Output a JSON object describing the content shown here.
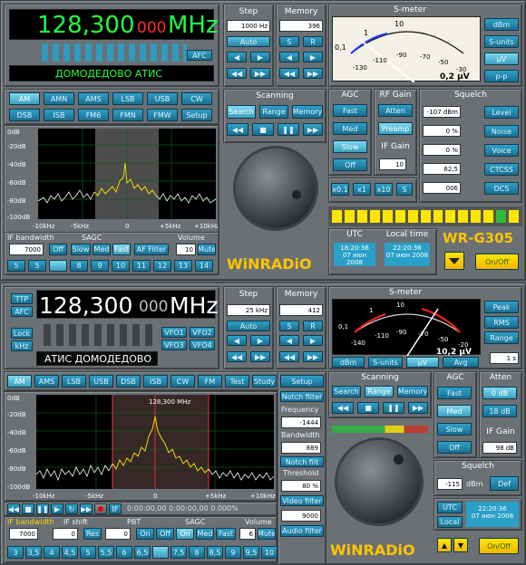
{
  "top": {
    "freq_main": "128,300",
    "freq_small": "000",
    "freq_unit": "MHz",
    "station": "ДОМОДЕДОВО АТИС",
    "afc": "AFC",
    "step": {
      "title": "Step",
      "value": "1000 Hz",
      "auto": "Auto"
    },
    "memory": {
      "title": "Memory",
      "value": "396",
      "s": "S",
      "r": "R"
    },
    "smeter": {
      "title": "S-meter",
      "reading": "0,2 μV",
      "scale": [
        "0,1",
        "1",
        "10",
        "-130",
        "-110",
        "-90",
        "-70",
        "-50",
        "-30"
      ],
      "buttons": [
        "dBm",
        "S-units",
        "μV",
        "p-p"
      ]
    },
    "modes": [
      "AM",
      "AMN",
      "AMS",
      "LSB",
      "USB",
      "CW",
      "DSB",
      "ISB",
      "FM6",
      "FMN",
      "FMW",
      "Setup"
    ],
    "scanning": {
      "title": "Scanning",
      "search": "Search",
      "range": "Range",
      "memory": "Memory"
    },
    "agc": {
      "title": "AGC",
      "items": [
        "Fast",
        "Med",
        "Slow",
        "Off"
      ]
    },
    "rfgain": {
      "title": "RF Gain",
      "atten": "Atten",
      "preamp": "Preamp",
      "ifgain_title": "IF Gain",
      "ifgain": "10"
    },
    "squelch": {
      "title": "Squelch",
      "values": [
        "-107 dBm",
        "0 %",
        "0 %",
        "62,5",
        "006"
      ],
      "buttons": [
        "Level",
        "Noise",
        "Voice",
        "CTCSS",
        "DCS"
      ]
    },
    "xbuttons": [
      "x0.1",
      "x1",
      "x10",
      "S"
    ],
    "spectrum": {
      "ylabels": [
        "0dB",
        "-20dB",
        "-40dB",
        "-60dB",
        "-80dB",
        "-100dB"
      ],
      "xlabels": [
        "-10kHz",
        "-5kHz",
        "0",
        "+5kHz",
        "+10kHz"
      ]
    },
    "bottom": {
      "ifbw_label": "IF bandwidth",
      "ifbw": "7000",
      "sagc": "SAGC",
      "off": "Off",
      "slow": "Slow",
      "med": "Med",
      "fast": "Fast",
      "affilter": "AF Filter",
      "volume_label": "Volume",
      "volume": "10",
      "mute": "Mute",
      "presets": [
        "5",
        "5",
        "",
        "8",
        "9",
        "10",
        "11",
        "12",
        "13",
        "14"
      ]
    },
    "clock": {
      "utc": "UTC",
      "local": "Local time",
      "utc_time": "18:20:36",
      "utc_date": "07 июн 2008",
      "local_time": "22:20:36",
      "local_date": "07 июн 2008"
    },
    "model": "WR-G305",
    "brand": "WiNRADiO",
    "onoff": "On/Off"
  },
  "bot": {
    "freq_main": "128,300",
    "freq_small": "000",
    "freq_unit": "MHz",
    "station": "АТИС ДОМОДЕДОВО",
    "ttp": "TTP",
    "afc": "AFC",
    "lock": "Lock",
    "khz": "kHz",
    "vfo": [
      "VFO1",
      "VFO2",
      "VFO3",
      "VFO4"
    ],
    "step": {
      "title": "Step",
      "value": "25 kHz",
      "auto": "Auto"
    },
    "memory": {
      "title": "Memory",
      "value": "412",
      "s": "S",
      "r": "R"
    },
    "smeter": {
      "title": "S-meter",
      "reading": "10,2 μV",
      "scale": [
        "0,1",
        "1",
        "10",
        "-140",
        "-110",
        "-90",
        "-70",
        "-50",
        "-20"
      ],
      "buttons": [
        "dBm",
        "S-units",
        "μV",
        "Avg"
      ],
      "side": [
        "Peak",
        "RMS",
        "Range"
      ],
      "range": "1 s"
    },
    "modes": [
      "AM",
      "AMS",
      "LSB",
      "USB",
      "DSB",
      "ISB",
      "CW",
      "FM",
      "Test",
      "Study",
      "Setup"
    ],
    "scanning": {
      "title": "Scanning",
      "search": "Search",
      "range": "Range",
      "memory": "Memory"
    },
    "agc": {
      "title": "AGC",
      "items": [
        "Fast",
        "Med",
        "Slow",
        "Off"
      ]
    },
    "atten": {
      "title": "Atten",
      "items": [
        "0 dB",
        "18 dB"
      ]
    },
    "ifgain": {
      "title": "IF Gain",
      "value": "98 dB"
    },
    "squelch": {
      "title": "Squelch",
      "value": "-115",
      "unit": "dBm",
      "def": "Def"
    },
    "right_tools": {
      "notch": "Notch filter",
      "freq_label": "Frequency",
      "freq": "-1444",
      "bw_label": "Bandwidth",
      "bw": "889",
      "notch_btn": "Notch filt",
      "thr_label": "Threshold",
      "thr": "80 %",
      "video": "Video filter",
      "video_val": "9000",
      "audio": "Audio filter"
    },
    "spectrum": {
      "marker": "128,300 MHz",
      "ylabels": [
        "0dB",
        "-20dB",
        "-40dB",
        "-60dB",
        "-80dB",
        "-100dB"
      ],
      "xlabels": [
        "-10kHz",
        "-5kHz",
        "0",
        "+5kHz",
        "+10kHz"
      ]
    },
    "recorder": {
      "time": "0:00:00,00  0:00:00,00 0.000%",
      "res": "Res"
    },
    "bottom": {
      "ifbw_label": "IF bandwidth",
      "ifshift_label": "IF shift",
      "pbt_label": "PBT",
      "sagc": "SAGC",
      "vol_label": "Volume",
      "ifbw": "7000",
      "ifshift": "0",
      "pbt": "0",
      "on": "On",
      "off": "Off",
      "med": "Med",
      "fast": "Fast",
      "vol": "6",
      "mute": "Mute",
      "presets": [
        "3",
        "3,5",
        "4",
        "4,5",
        "5",
        "5,5",
        "6",
        "6,5",
        "",
        "7,5",
        "8",
        "8,5",
        "9",
        "9,5",
        "10"
      ]
    },
    "clock": {
      "utc": "UTC",
      "local": "Local",
      "time": "22:20:36",
      "date": "07 июн 2008"
    },
    "brand": "WiNRADiO",
    "onoff": "On/Off"
  }
}
